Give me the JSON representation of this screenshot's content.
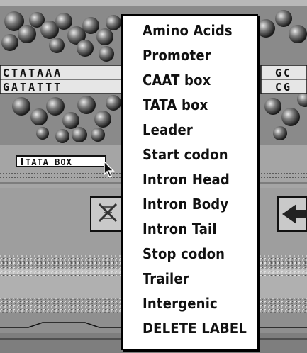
{
  "dna_view": {
    "label_tag": "TATA BOX",
    "left_strand_top": "CTATAAA",
    "left_strand_bottom": "GATATTT",
    "right_strand_top": "GC",
    "right_strand_bottom": "CG"
  },
  "label_menu": {
    "items": [
      "Amino Acids",
      "Promoter",
      "CAAT box",
      "TATA box",
      "Leader",
      "Start codon",
      "Intron Head",
      "Intron Body",
      "Intron Tail",
      "Stop codon",
      "Trailer",
      "Intergenic",
      "DELETE LABEL"
    ]
  },
  "icons": {
    "cursor": "arrow-pointer-icon",
    "dna_button": "dna-helix-icon",
    "nav": "left-arrow-icon"
  }
}
